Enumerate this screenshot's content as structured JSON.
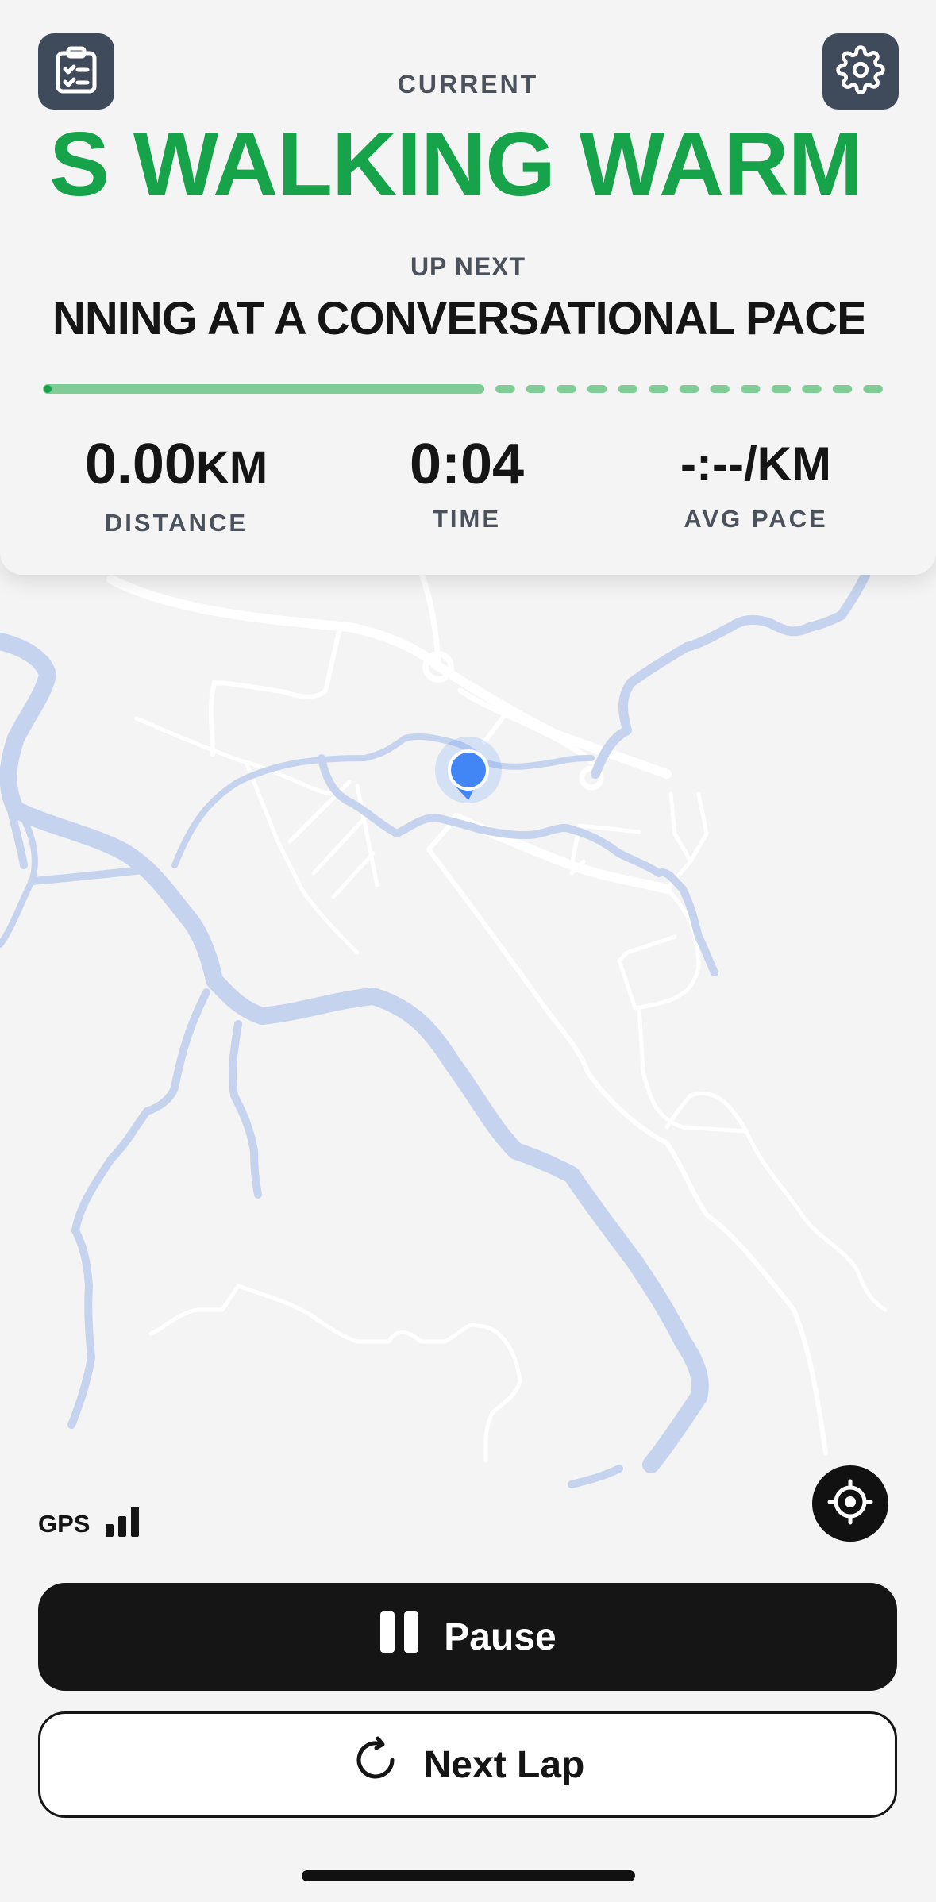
{
  "header": {
    "current_label": "CURRENT",
    "current_step": "S WALKING WARM UP",
    "next_label": "UP NEXT",
    "next_step": "NNING AT A CONVERSATIONAL PACE"
  },
  "progress": {
    "completed_fraction": 0.5,
    "remaining_segments": 13
  },
  "stats": {
    "distance": {
      "value": "0.00",
      "unit": "KM",
      "label": "DISTANCE"
    },
    "time": {
      "value": "0:04",
      "label": "TIME"
    },
    "pace": {
      "value": "-:--/KM",
      "label": "AVG PACE"
    }
  },
  "gps": {
    "label": "GPS",
    "signal_bars": 3
  },
  "buttons": {
    "pause_label": "Pause",
    "next_lap_label": "Next Lap"
  },
  "icons": {
    "workout": "clipboard-checklist-icon",
    "settings": "gear-icon",
    "locate": "crosshair-icon",
    "pause": "pause-icon",
    "next_lap": "refresh-icon"
  },
  "colors": {
    "accent_green": "#17a34a",
    "progress_green": "#7fcc97",
    "map_water": "#c5d3ee",
    "location_dot": "#4285f4",
    "dark": "#151515"
  }
}
